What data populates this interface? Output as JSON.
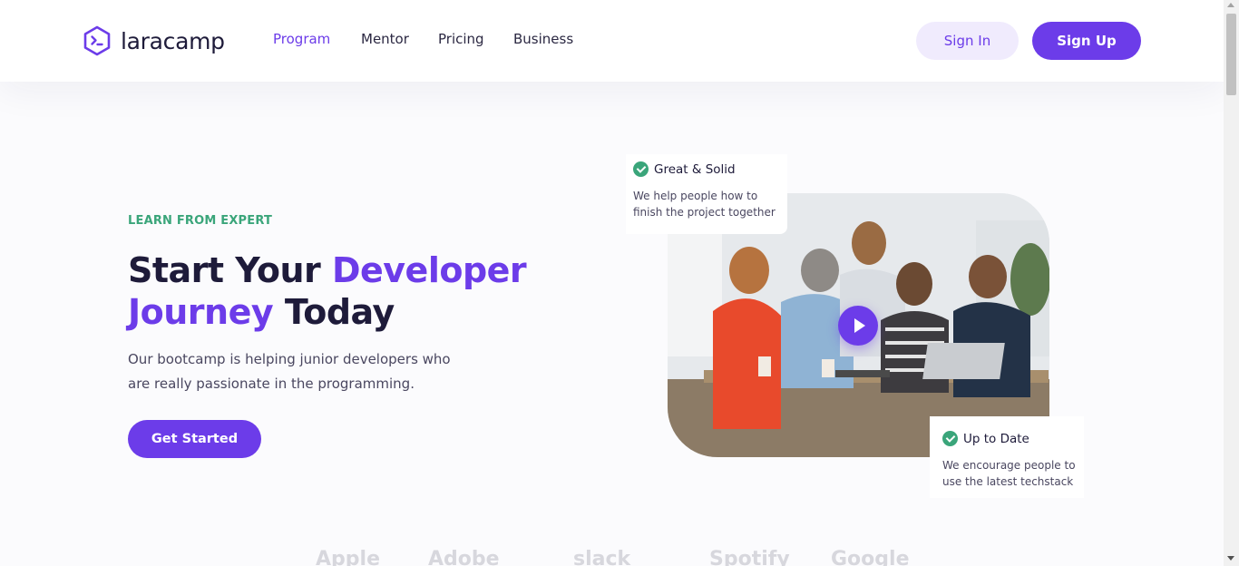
{
  "brand": {
    "name": "laracamp",
    "icon": "terminal-hexagon-icon",
    "accent": "#6c3ce9"
  },
  "nav": {
    "links": [
      {
        "label": "Program",
        "active": true
      },
      {
        "label": "Mentor",
        "active": false
      },
      {
        "label": "Pricing",
        "active": false
      },
      {
        "label": "Business",
        "active": false
      }
    ],
    "sign_in": "Sign In",
    "sign_up": "Sign Up"
  },
  "hero": {
    "eyebrow": "LEARN FROM EXPERT",
    "headline_part1": "Start Your ",
    "headline_accent1": "Developer",
    "headline_accent2": "Journey",
    "headline_part2": " Today",
    "subtext": "Our bootcamp is helping junior developers who are really passionate in the programming.",
    "cta": "Get Started",
    "green": "#3aa57a"
  },
  "features": [
    {
      "title": "Great & Solid",
      "desc_line1": "We help people how to",
      "desc_line2": "finish the project together"
    },
    {
      "title": "Up to Date",
      "desc_line1": "We encourage people to",
      "desc_line2": "use the latest techstack"
    }
  ],
  "partners": [
    "Apple",
    "Adobe",
    "slack",
    "Spotify",
    "Google"
  ]
}
